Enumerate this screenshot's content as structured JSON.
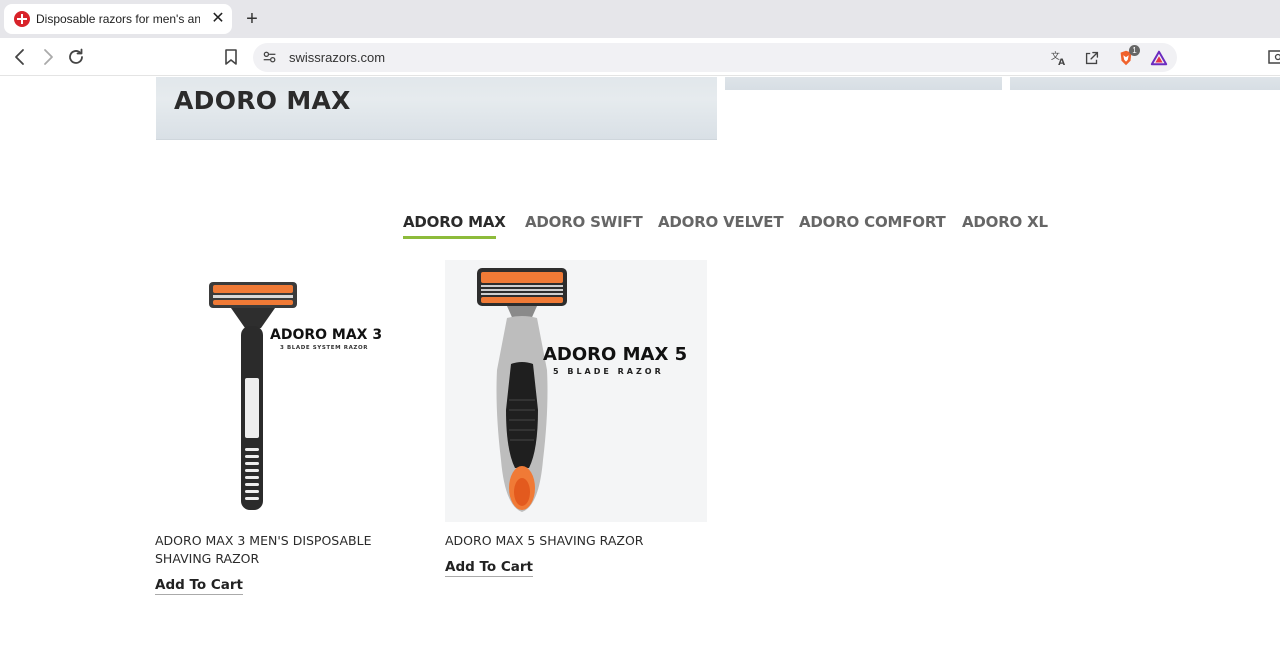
{
  "browser": {
    "tab_title": "Disposable razors for men's and",
    "tab_close": "✕",
    "new_tab": "+",
    "url": "swissrazors.com",
    "shields_count": "1"
  },
  "hero": {
    "title": "ADORO MAX"
  },
  "category_tabs": [
    {
      "label": "ADORO MAX",
      "active": true
    },
    {
      "label": "ADORO SWIFT",
      "active": false
    },
    {
      "label": "ADORO VELVET",
      "active": false
    },
    {
      "label": "ADORO COMFORT",
      "active": false
    },
    {
      "label": "ADORO XL",
      "active": false
    }
  ],
  "products": [
    {
      "name": "ADORO MAX 3 MEN'S DISPOSABLE SHAVING RAZOR",
      "image_title": "ADORO MAX 3",
      "image_subtitle": "3 BLADE SYSTEM RAZOR",
      "cta": "Add To Cart"
    },
    {
      "name": "ADORO MAX 5 SHAVING RAZOR",
      "image_title": "ADORO MAX 5",
      "image_subtitle": "5 BLADE RAZOR",
      "cta": "Add To Cart"
    }
  ],
  "colors": {
    "accent_underline": "#8dbb3b",
    "razor_orange": "#f07a36",
    "favicon_red": "#d8232a"
  }
}
